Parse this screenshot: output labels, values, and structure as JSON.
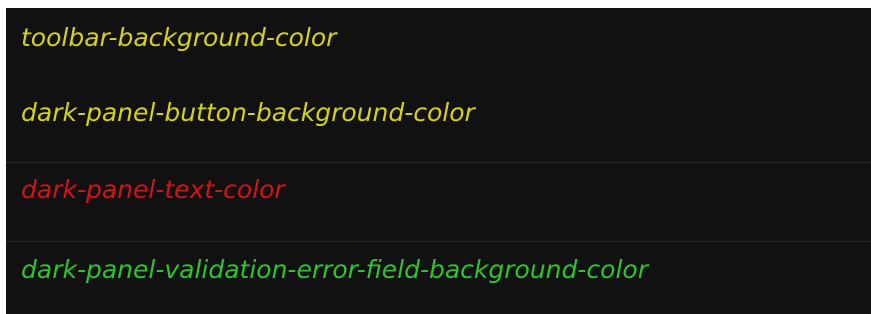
{
  "items": [
    {
      "label": "toolbar-background-color",
      "color": "#d6d11a"
    },
    {
      "label": "dark-panel-button-background-color",
      "color": "#d6d11a"
    },
    {
      "label": "dark-panel-text-color",
      "color": "#d21414"
    },
    {
      "label": "dark-panel-validation-error-field-background-color",
      "color": "#2fc42f"
    }
  ]
}
